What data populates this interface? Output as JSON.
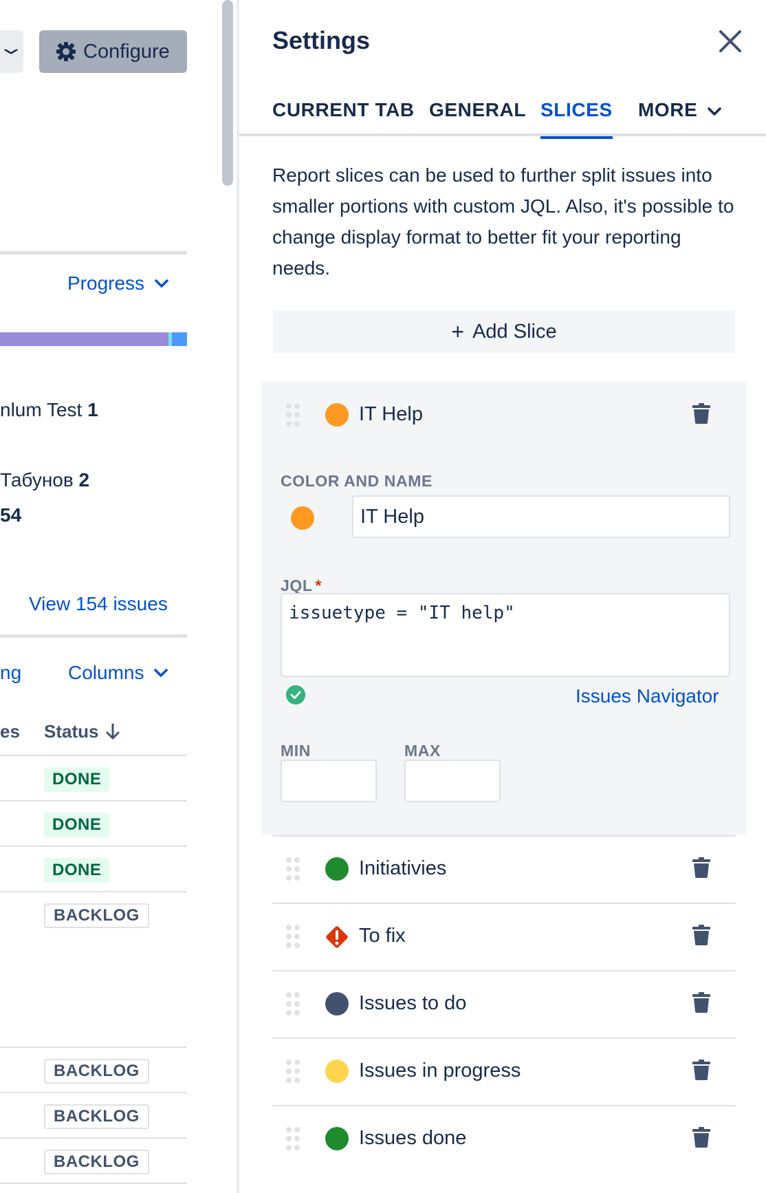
{
  "left": {
    "configure_label": "Configure",
    "progress_label": "Progress",
    "row1_text": "nlum Test ",
    "row1_count": "1",
    "row2_text": "Табунов ",
    "row2_count": "2",
    "total": "54",
    "view_issues_label": "View 154 issues",
    "partial_ng": "ng",
    "columns_label": "Columns",
    "partial_es": "es",
    "status_header": "Status",
    "statuses": [
      "DONE",
      "DONE",
      "DONE",
      "BACKLOG",
      "BACKLOG",
      "BACKLOG",
      "BACKLOG"
    ]
  },
  "settings": {
    "title": "Settings",
    "tabs": [
      {
        "label": "CURRENT TAB"
      },
      {
        "label": "GENERAL"
      },
      {
        "label": "SLICES"
      },
      {
        "label": "MORE"
      }
    ],
    "description": "Report slices can be used to further split issues into smaller portions with custom JQL. Also, it's possible to change display format to better fit your reporting needs.",
    "add_slice_label": "Add Slice",
    "expanded_slice": {
      "name": "IT Help",
      "color": "#ff991f",
      "color_and_name_label": "COLOR AND NAME",
      "name_value": "IT Help",
      "jql_label": "JQL",
      "jql_required": "*",
      "jql_value": "issuetype = \"IT help\"",
      "issues_navigator_label": "Issues Navigator",
      "min_label": "MIN",
      "max_label": "MAX",
      "min_value": "",
      "max_value": ""
    },
    "slices": [
      {
        "name": "Initiativies",
        "color": "#1f8a2e",
        "icon": "dot"
      },
      {
        "name": "To fix",
        "color": "#de350b",
        "icon": "warning-diamond-icon"
      },
      {
        "name": "Issues to do",
        "color": "#42526e",
        "icon": "dot"
      },
      {
        "name": "Issues in progress",
        "color": "#ffd54f",
        "icon": "dot"
      },
      {
        "name": "Issues done",
        "color": "#1f8a2e",
        "icon": "dot"
      }
    ]
  }
}
